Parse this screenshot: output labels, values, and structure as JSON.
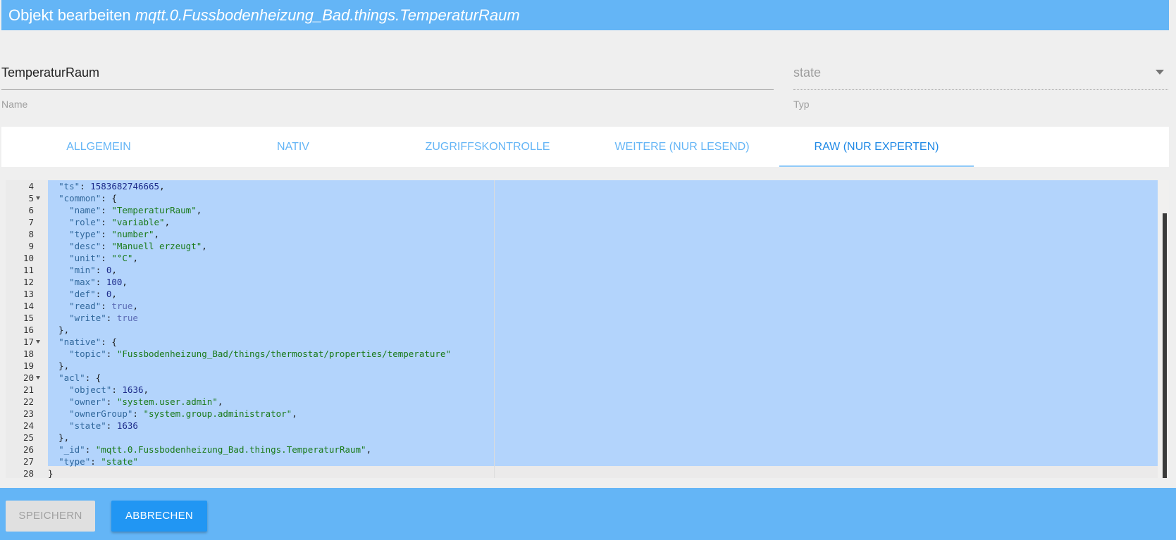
{
  "header": {
    "prefix": "Objekt bearbeiten",
    "object_id": "mqtt.0.Fussbodenheizung_Bad.things.TemperaturRaum"
  },
  "name_field": {
    "value": "TemperaturRaum",
    "label": "Name"
  },
  "type_field": {
    "value": "state",
    "label": "Typ"
  },
  "tabs": [
    {
      "label": "ALLGEMEIN"
    },
    {
      "label": "NATIV"
    },
    {
      "label": "ZUGRIFFSKONTROLLE"
    },
    {
      "label": "WEITERE (NUR LESEND)"
    },
    {
      "label": "RAW (NUR EXPERTEN)",
      "active": true
    }
  ],
  "editor": {
    "lines": [
      {
        "n": "4",
        "fold": false,
        "html": "  <span class=\"k\">\"ts\"</span>: <span class=\"n\">1583682746665</span>,"
      },
      {
        "n": "5",
        "fold": true,
        "html": "  <span class=\"k\">\"common\"</span>: {"
      },
      {
        "n": "6",
        "fold": false,
        "html": "    <span class=\"k\">\"name\"</span>: <span class=\"s\">\"TemperaturRaum\"</span>,"
      },
      {
        "n": "7",
        "fold": false,
        "html": "    <span class=\"k\">\"role\"</span>: <span class=\"s\">\"variable\"</span>,"
      },
      {
        "n": "8",
        "fold": false,
        "html": "    <span class=\"k\">\"type\"</span>: <span class=\"s\">\"number\"</span>,"
      },
      {
        "n": "9",
        "fold": false,
        "html": "    <span class=\"k\">\"desc\"</span>: <span class=\"s\">\"Manuell erzeugt\"</span>,"
      },
      {
        "n": "10",
        "fold": false,
        "html": "    <span class=\"k\">\"unit\"</span>: <span class=\"s\">\"°C\"</span>,"
      },
      {
        "n": "11",
        "fold": false,
        "html": "    <span class=\"k\">\"min\"</span>: <span class=\"n\">0</span>,"
      },
      {
        "n": "12",
        "fold": false,
        "html": "    <span class=\"k\">\"max\"</span>: <span class=\"n\">100</span>,"
      },
      {
        "n": "13",
        "fold": false,
        "html": "    <span class=\"k\">\"def\"</span>: <span class=\"n\">0</span>,"
      },
      {
        "n": "14",
        "fold": false,
        "html": "    <span class=\"k\">\"read\"</span>: <span class=\"b\">true</span>,"
      },
      {
        "n": "15",
        "fold": false,
        "html": "    <span class=\"k\">\"write\"</span>: <span class=\"b\">true</span>"
      },
      {
        "n": "16",
        "fold": false,
        "html": "  },"
      },
      {
        "n": "17",
        "fold": true,
        "html": "  <span class=\"k\">\"native\"</span>: {"
      },
      {
        "n": "18",
        "fold": false,
        "html": "    <span class=\"k\">\"topic\"</span>: <span class=\"s\">\"Fussbodenheizung_Bad/things/thermostat/properties/temperature\"</span>"
      },
      {
        "n": "19",
        "fold": false,
        "html": "  },"
      },
      {
        "n": "20",
        "fold": true,
        "html": "  <span class=\"k\">\"acl\"</span>: {"
      },
      {
        "n": "21",
        "fold": false,
        "html": "    <span class=\"k\">\"object\"</span>: <span class=\"n\">1636</span>,"
      },
      {
        "n": "22",
        "fold": false,
        "html": "    <span class=\"k\">\"owner\"</span>: <span class=\"s\">\"system.user.admin\"</span>,"
      },
      {
        "n": "23",
        "fold": false,
        "html": "    <span class=\"k\">\"ownerGroup\"</span>: <span class=\"s\">\"system.group.administrator\"</span>,"
      },
      {
        "n": "24",
        "fold": false,
        "html": "    <span class=\"k\">\"state\"</span>: <span class=\"n\">1636</span>"
      },
      {
        "n": "25",
        "fold": false,
        "html": "  },"
      },
      {
        "n": "26",
        "fold": false,
        "html": "  <span class=\"k\">\"_id\"</span>: <span class=\"s\">\"mqtt.0.Fussbodenheizung_Bad.things.TemperaturRaum\"</span>,"
      },
      {
        "n": "27",
        "fold": false,
        "html": "  <span class=\"k\">\"type\"</span>: <span class=\"s\">\"state\"</span>"
      },
      {
        "n": "28",
        "fold": false,
        "html": "}"
      }
    ]
  },
  "footer": {
    "save_label": "SPEICHERN",
    "cancel_label": "ABBRECHEN"
  },
  "colors": {
    "primary": "#64b5f6",
    "accent": "#2196f3",
    "selection": "#b3d4fc"
  }
}
